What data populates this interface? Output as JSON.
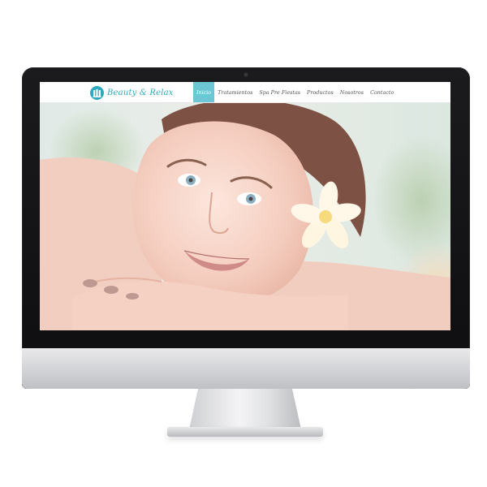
{
  "site": {
    "logo_text": "Beauty & Relax"
  },
  "nav": {
    "items": [
      {
        "label": "Inicio",
        "active": true
      },
      {
        "label": "Tratamientos",
        "active": false
      },
      {
        "label": "Spa Pre Fiestas",
        "active": false
      },
      {
        "label": "Productos",
        "active": false
      },
      {
        "label": "Nosotros",
        "active": false
      },
      {
        "label": "Contacto",
        "active": false
      }
    ]
  },
  "hero": {
    "image_subject": "woman-resting-with-flower"
  },
  "colors": {
    "accent": "#2ea9bd",
    "active_tab": "#6cc6d3",
    "bezel": "#111113",
    "chin": "#d2d3d6"
  }
}
